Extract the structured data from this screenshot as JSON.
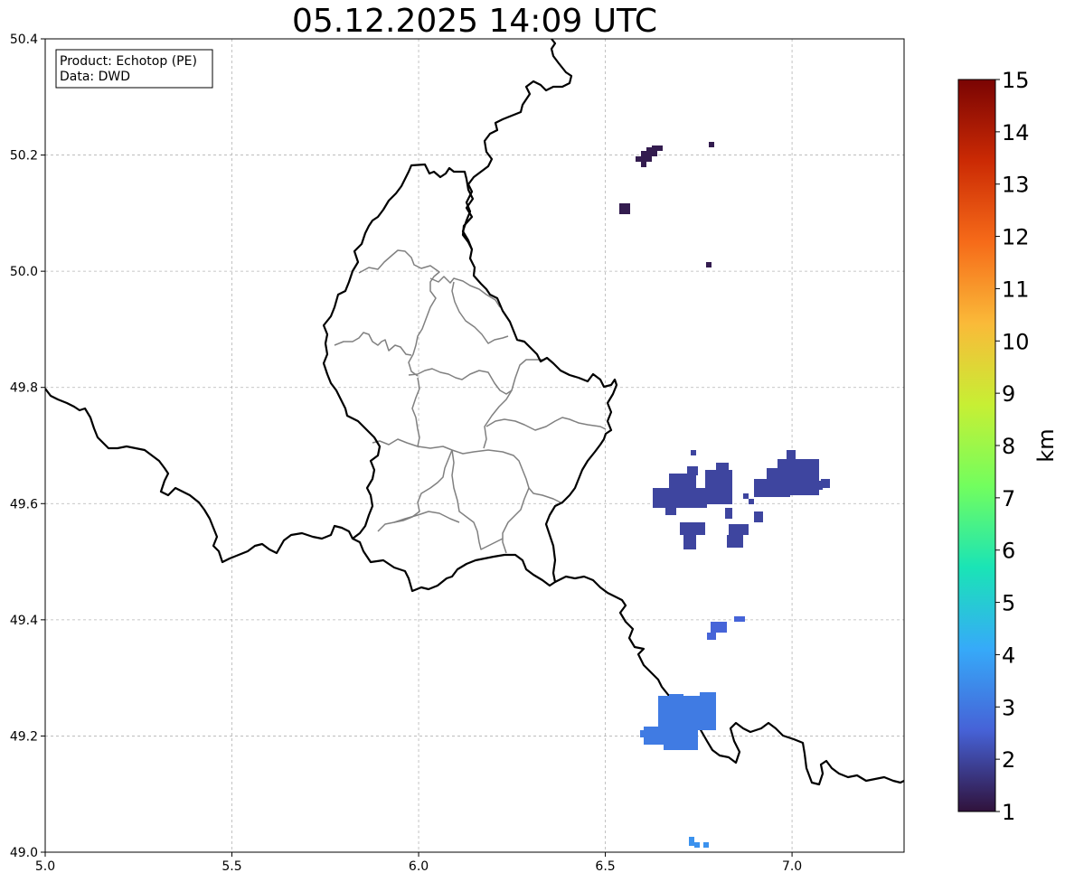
{
  "title": "05.12.2025 14:09 UTC",
  "info_box": {
    "product_line": "Product: Echotop (PE)",
    "data_line": "Data: DWD"
  },
  "map": {
    "lon_range": [
      5.0,
      7.3
    ],
    "lat_range": [
      49.0,
      50.4
    ],
    "x_ticks": [
      "5.0",
      "5.5",
      "6.0",
      "6.5",
      "7.0"
    ],
    "y_ticks": [
      "49.0",
      "49.2",
      "49.4",
      "49.6",
      "49.8",
      "50.0",
      "50.2",
      "50.4"
    ],
    "grid": "dashed light gray",
    "country_border_color": "#000000",
    "district_border_color": "#808080"
  },
  "colorbar": {
    "label": "km",
    "ticks": [
      "1",
      "2",
      "3",
      "4",
      "5",
      "6",
      "7",
      "8",
      "9",
      "10",
      "11",
      "12",
      "13",
      "14",
      "15"
    ],
    "range": [
      1,
      15
    ],
    "colormap": "turbo",
    "stops": [
      "#30123b",
      "#4662d7",
      "#36aaf9",
      "#1ae4b6",
      "#72fe5e",
      "#c7ef34",
      "#faba39",
      "#f66b19",
      "#cb2a04",
      "#7a0403"
    ]
  },
  "echo_cells": [
    {
      "area": "north-east small cells",
      "echotop_km": 1.2
    },
    {
      "area": "east cluster near 49.62N 6.8-7.1E",
      "echotop_km": 2.0
    },
    {
      "area": "cells near 49.38N 6.8E",
      "echotop_km": 2.6
    },
    {
      "area": "cell near 49.22N 6.75E",
      "echotop_km": 3.1
    },
    {
      "area": "cell near 49.02N 6.75E",
      "echotop_km": 3.6
    }
  ]
}
